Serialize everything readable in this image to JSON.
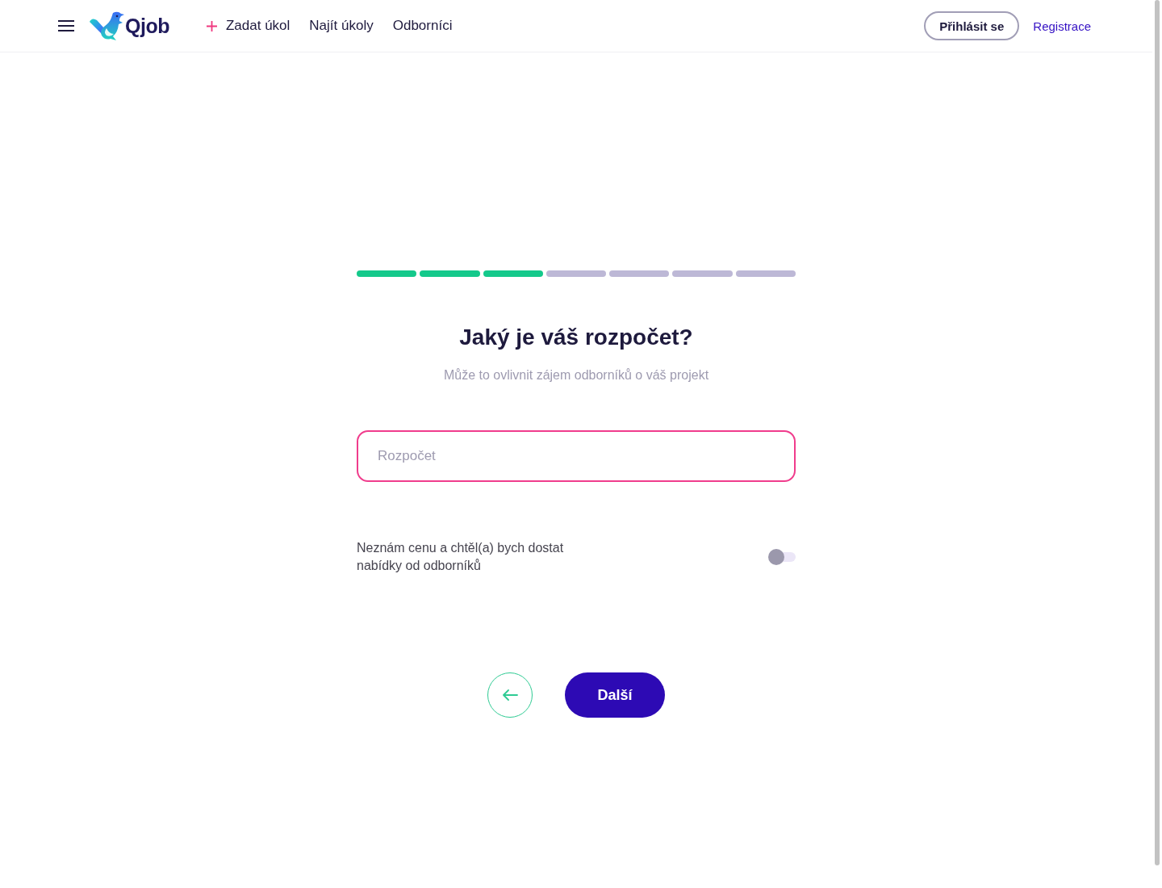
{
  "header": {
    "logo_text": "Qjob",
    "nav": [
      {
        "label": "Zadat úkol",
        "kind": "add"
      },
      {
        "label": "Najít úkoly",
        "kind": "link"
      },
      {
        "label": "Odborníci",
        "kind": "link"
      }
    ],
    "login_button": "Přihlásit se",
    "register_link": "Registrace"
  },
  "progress": {
    "steps": [
      {
        "completed": true
      },
      {
        "completed": true
      },
      {
        "completed": true
      },
      {
        "completed": false
      },
      {
        "completed": false
      },
      {
        "completed": false
      },
      {
        "completed": false
      }
    ]
  },
  "question": {
    "title": "Jaký je váš rozpočet?",
    "subtitle": "Může to ovlivnit zájem odborníků o váš projekt"
  },
  "budget_field": {
    "placeholder": "Rozpočet"
  },
  "price_toggle": {
    "label": "Neznám cenu a chtěl(a) bych dostat nabídky od odborníků",
    "on": false
  },
  "next_button": "Další"
}
